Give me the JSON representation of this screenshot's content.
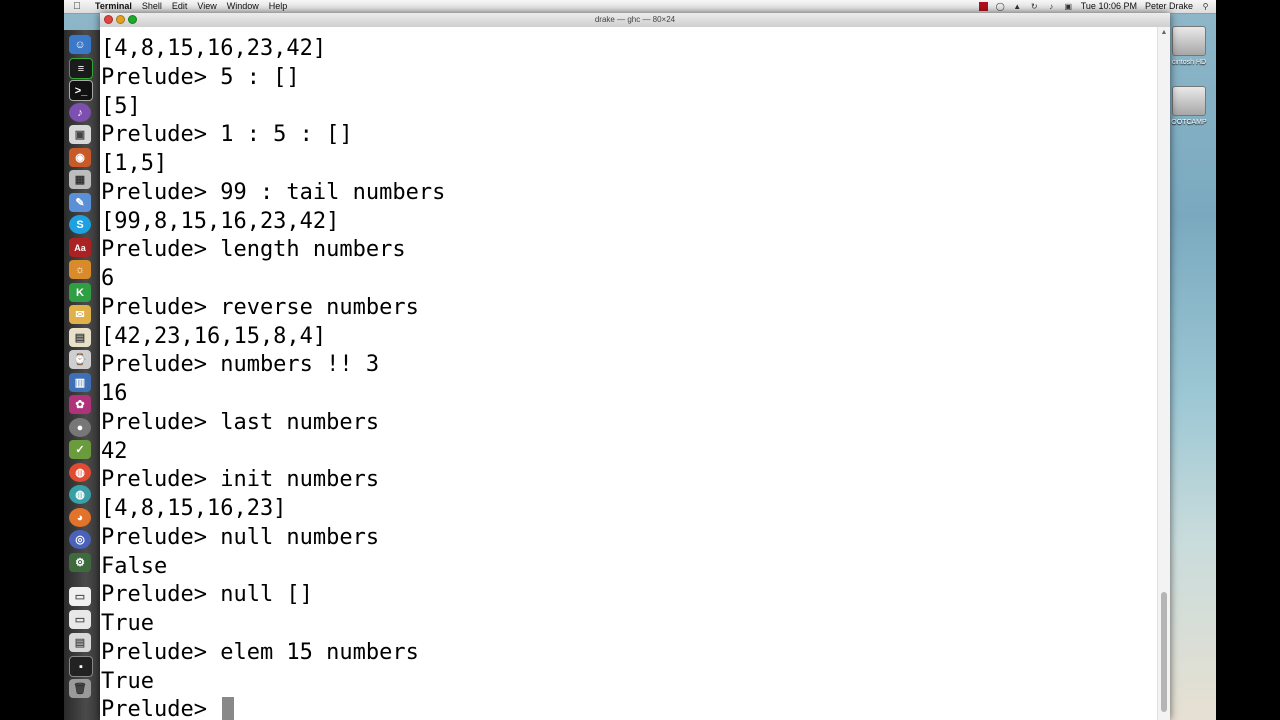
{
  "menubar": {
    "app": "Terminal",
    "items": [
      "Shell",
      "Edit",
      "View",
      "Window",
      "Help"
    ],
    "clock": "Tue 10:06 PM",
    "user": "Peter Drake"
  },
  "window": {
    "title": "drake — ghc — 80×24"
  },
  "terminal": {
    "lines": [
      "[4,8,15,16,23,42]",
      "Prelude> 5 : []",
      "[5]",
      "Prelude> 1 : 5 : []",
      "[1,5]",
      "Prelude> 99 : tail numbers",
      "[99,8,15,16,23,42]",
      "Prelude> length numbers",
      "6",
      "Prelude> reverse numbers",
      "[42,23,16,15,8,4]",
      "Prelude> numbers !! 3",
      "16",
      "Prelude> last numbers",
      "42",
      "Prelude> init numbers",
      "[4,8,15,16,23]",
      "Prelude> null numbers",
      "False",
      "Prelude> null []",
      "True",
      "Prelude> elem 15 numbers",
      "True"
    ],
    "prompt": "Prelude> "
  },
  "desktop": {
    "drives": [
      "cintosh HD",
      "OOTCAMP"
    ]
  },
  "dock_icons": [
    "finder-icon",
    "activity-monitor-icon",
    "terminal-icon",
    "itunes-icon",
    "preview-icon",
    "photo-icon",
    "calculator-icon",
    "xcode-icon",
    "skype-icon",
    "dictionary-icon",
    "app-icon-1",
    "app-icon-2",
    "app-icon-3",
    "app-icon-4",
    "app-icon-5",
    "app-icon-6",
    "app-icon-7",
    "chrome-icon",
    "chrome-canary-icon",
    "firefox-icon",
    "safari-icon",
    "app-icon-8",
    "document-icon",
    "document-icon-2",
    "app-icon-9",
    "app-icon-10",
    "trash-icon"
  ]
}
